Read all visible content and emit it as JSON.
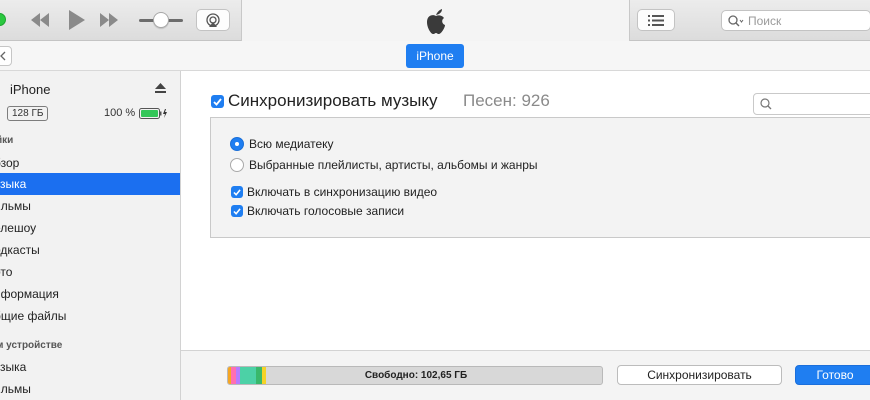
{
  "toolbar": {
    "search_placeholder": "Поиск",
    "icons": [
      "rewind-icon",
      "play-icon",
      "fast-forward-icon",
      "volume-slider",
      "airplay-icon",
      "apple-logo-icon",
      "list-icon",
      "search-icon"
    ]
  },
  "device_bar": {
    "device_tab": "iPhone"
  },
  "sidebar": {
    "device_name": "iPhone",
    "capacity": "128 ГБ",
    "battery": "100 %",
    "settings_header": "йки",
    "items": [
      {
        "label": "бзор",
        "selected": false
      },
      {
        "label": "узыка",
        "selected": true
      },
      {
        "label": "ильмы",
        "selected": false
      },
      {
        "label": "елешоу",
        "selected": false
      },
      {
        "label": "одкасты",
        "selected": false
      },
      {
        "label": "ото",
        "selected": false
      },
      {
        "label": "нформация",
        "selected": false
      },
      {
        "label": "бщие файлы",
        "selected": false
      }
    ],
    "on_device_header": "м устройстве",
    "device_items": [
      {
        "label": "узыка"
      },
      {
        "label": "ильмы"
      }
    ]
  },
  "main": {
    "sync_title": "Синхронизировать музыку",
    "sync_checked": true,
    "song_count": "Песен: 926",
    "radio_options": [
      {
        "label": "Всю медиатеку",
        "selected": true
      },
      {
        "label": "Выбранные плейлисты, артисты, альбомы и жанры",
        "selected": false
      }
    ],
    "checkboxes": [
      {
        "label": "Включать в синхронизацию видео",
        "checked": true
      },
      {
        "label": "Включать голосовые записи",
        "checked": true
      }
    ]
  },
  "bottom": {
    "free_space": "Свободно: 102,65 ГБ",
    "sync_button": "Синхронизировать",
    "done_button": "Готово"
  },
  "colors": {
    "accent": "#1f7ef1",
    "battery_green": "#34c759"
  }
}
